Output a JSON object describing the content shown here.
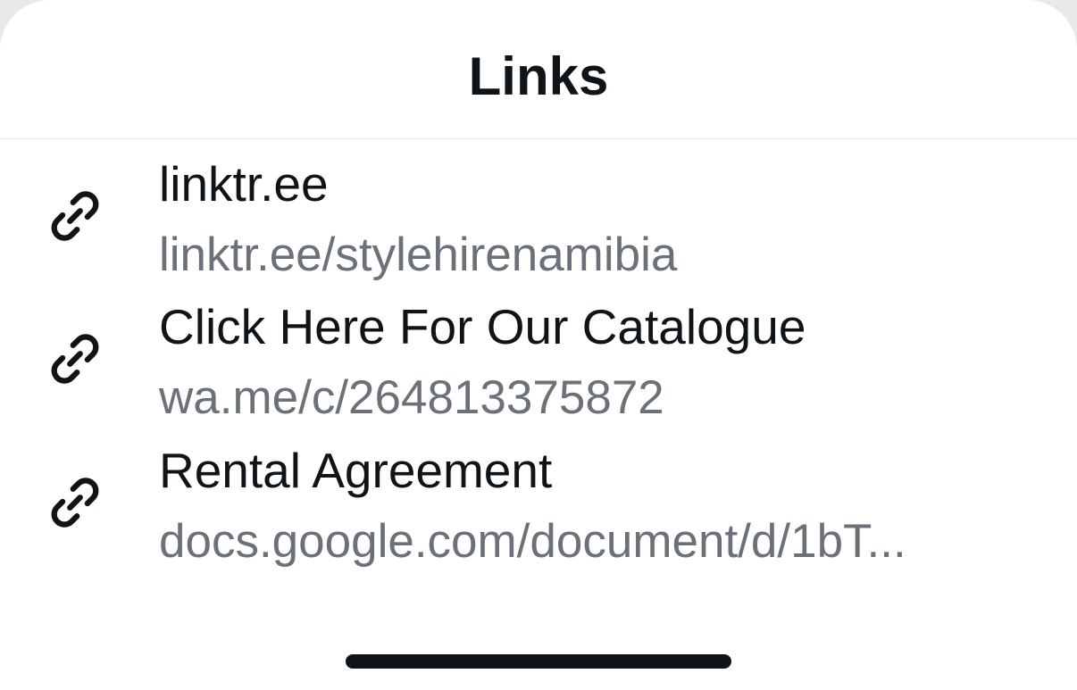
{
  "header": {
    "title": "Links"
  },
  "links": [
    {
      "title": "linktr.ee",
      "url": "linktr.ee/stylehirenamibia",
      "icon": "link-icon"
    },
    {
      "title": "Click Here For Our Catalogue",
      "url": "wa.me/c/264813375872",
      "icon": "link-icon"
    },
    {
      "title": "Rental Agreement",
      "url": "docs.google.com/document/d/1bT...",
      "icon": "link-icon"
    }
  ],
  "colors": {
    "primary_text": "#0f1419",
    "secondary_text": "#6b7179",
    "background": "#ffffff"
  }
}
